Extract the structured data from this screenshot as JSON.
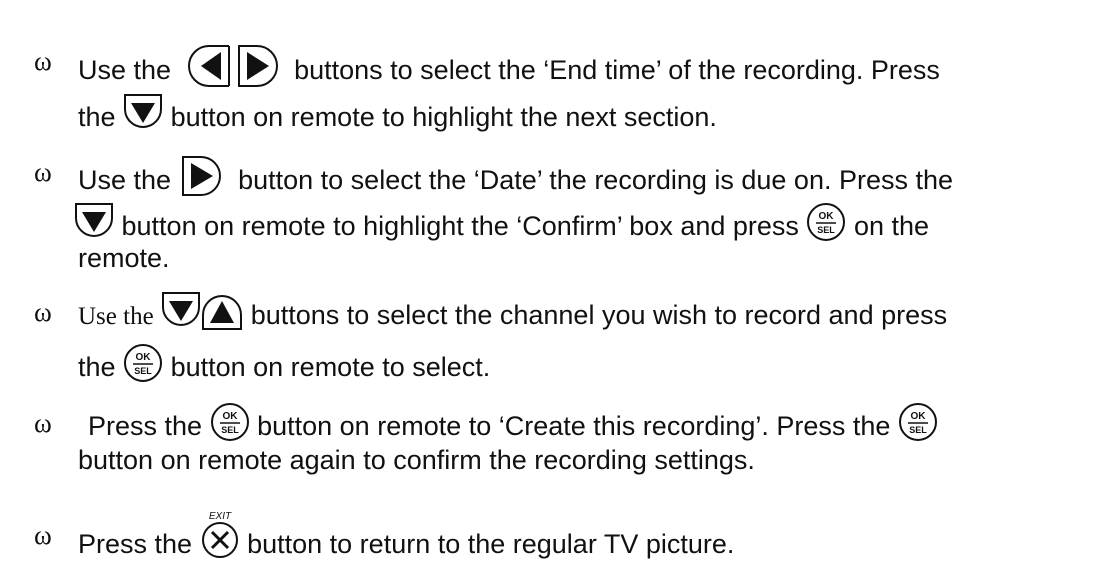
{
  "bullet_glyph": "ω",
  "items": [
    {
      "line1_pre": "Use the",
      "line1_post": "buttons to select the ‘End time’ of the recording.  Press",
      "line2_pre": "the",
      "line2_post": "button on remote to highlight the next section."
    },
    {
      "line1_pre": "Use the",
      "line1_post": "button to select the ‘Date’ the recording is due on. Press the",
      "line2_post_a": "button on remote to highlight the ‘Confirm’ box and press",
      "line2_post_b": "on the",
      "line3": "remote."
    },
    {
      "line1_pre": "Use the",
      "line1_post": "buttons to select the channel you wish to record and press",
      "line2_pre": "the",
      "line2_post": "button on remote to select."
    },
    {
      "line1_pre": "Press the",
      "line1_mid": "button on remote to ‘Create this recording’. Press the",
      "line2": "button on remote again to confirm the recording settings."
    },
    {
      "line1_pre": "Press the",
      "line1_post": "button to return to the regular TV picture."
    }
  ],
  "icons": {
    "ok_top": "OK",
    "ok_bottom": "SEL",
    "exit_label": "EXIT"
  }
}
